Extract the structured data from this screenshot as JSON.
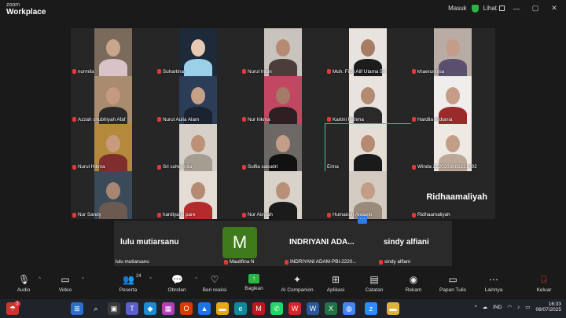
{
  "app": {
    "brand_small": "zoom",
    "brand_name": "Workplace"
  },
  "titlebar": {
    "masuk": "Masuk",
    "lihat": "Lihat"
  },
  "gallery": [
    {
      "name": "nurmila",
      "bg": "#7a6a5c",
      "skin": "#c9a58b",
      "cloth": "#d9c3c9",
      "mic_off": true
    },
    {
      "name": "Suhartina",
      "bg": "#1c2a3a",
      "skin": "#e8c9b3",
      "cloth": "#9ad0e8",
      "mic_off": true
    },
    {
      "name": "Nurul Intan",
      "bg": "#c9c3bd",
      "skin": "#b58a73",
      "cloth": "#4a3d3a",
      "mic_off": true
    },
    {
      "name": "Muh. Fidri Alif Utama 54",
      "bg": "#e7e4e0",
      "skin": "#a77b64",
      "cloth": "#1c1c1c",
      "mic_off": true
    },
    {
      "name": "khaerunnisa",
      "bg": "#b9aca4",
      "skin": "#c49c88",
      "cloth": "#5a4f6e",
      "mic_off": true
    },
    {
      "name": "Azzah shubhiyah Afaf",
      "bg": "#a98b6f",
      "skin": "#c59a80",
      "cloth": "#2a2a2a",
      "mic_off": true
    },
    {
      "name": "Nurul Aulia Alam",
      "bg": "#2c3d58",
      "skin": "#c6a087",
      "cloth": "#1b2230",
      "mic_off": true
    },
    {
      "name": "Nur hikma",
      "bg": "#c24762",
      "skin": "#a57a66",
      "cloth": "#2d1f22",
      "mic_off": true
    },
    {
      "name": "Kartini Rahma",
      "bg": "#e8e3df",
      "skin": "#b38b73",
      "cloth": "#2a2a2a",
      "mic_off": true
    },
    {
      "name": "Hardila Ardiania",
      "bg": "#efeeed",
      "skin": "#c59d86",
      "cloth": "#9b2b2b",
      "mic_off": true
    },
    {
      "name": "Nurul Hikma",
      "bg": "#b38a3c",
      "skin": "#c89b7e",
      "cloth": "#7f2d2d",
      "mic_off": true
    },
    {
      "name": "Sri suhermita",
      "bg": "#d6d0c8",
      "skin": "#bc9178",
      "cloth": "#a69d92",
      "mic_off": true
    },
    {
      "name": "Sulfia sabudri",
      "bg": "#6b6866",
      "skin": "#c59d88",
      "cloth": "#111111",
      "mic_off": true
    },
    {
      "name": "Erina",
      "bg": "#e4ded6",
      "skin": "#b58a73",
      "cloth": "#1a1a1a",
      "mic_off": false,
      "active": true
    },
    {
      "name": "Winda 2220203886231002",
      "bg": "#eee9e3",
      "skin": "#c29e89",
      "cloth": "#bca899",
      "mic_off": true
    },
    {
      "name": "Nur Sandy",
      "bg": "#3b4a58",
      "skin": "#a98672",
      "cloth": "#6b5a52",
      "mic_off": true
    },
    {
      "name": "hardiyanti pare",
      "bg": "#e3ddd5",
      "skin": "#b48a72",
      "cloth": "#b52b2b",
      "mic_off": true
    },
    {
      "name": "Nur Aisyiah",
      "bg": "#d8d2cb",
      "skin": "#b98f77",
      "cloth": "#1b1b1b",
      "mic_off": true
    },
    {
      "name": "Humairah Argianti",
      "bg": "#d3cac1",
      "skin": "#c39d86",
      "cloth": "#9a8a7c",
      "mic_off": true
    },
    {
      "name": "Ridhaamaliyah",
      "bg": "#232323",
      "mic_off": true,
      "big_name": "Ridhaamaliyah"
    }
  ],
  "strip": [
    {
      "big": "lulu mutiarsanu",
      "name": "lulu mutiarsanu"
    },
    {
      "avatar_letter": "M",
      "name": "Maulifina N"
    },
    {
      "big": "INDRIYANI ADA...",
      "name": "INDRIYANI ADAM-PBI-2220..."
    },
    {
      "big": "sindy alfiani",
      "name": "sindy alfiani"
    }
  ],
  "toolbar": {
    "audio": "Audio",
    "video": "Video",
    "participants": "Peserta",
    "participants_count": "24",
    "chat": "Obrolan",
    "reactions": "Beri reaksi",
    "share": "Bagikan",
    "companion": "AI Companion",
    "apps": "Aplikasi",
    "notes": "Catatan",
    "record": "Rekam",
    "whiteboard": "Papan Tulis",
    "more": "Lainnya",
    "leave": "Keluar"
  },
  "taskbar": {
    "badge": "3",
    "lang": "IND",
    "time": "16:33",
    "date": "06/07/2025"
  }
}
